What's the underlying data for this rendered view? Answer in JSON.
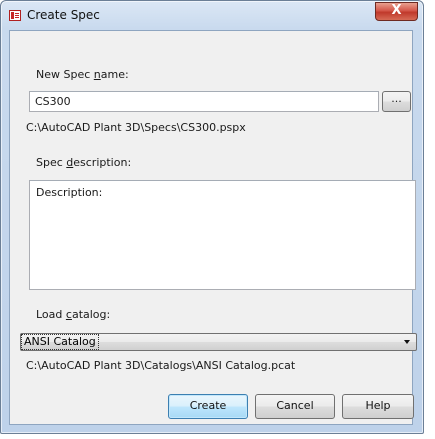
{
  "window": {
    "title": "Create Spec",
    "close_glyph": "X"
  },
  "spec_name": {
    "label_pre": "New Spec ",
    "label_key": "n",
    "label_post": "ame:",
    "value": "CS300",
    "browse_label": "...",
    "path": "C:\\AutoCAD Plant 3D\\Specs\\CS300.pspx"
  },
  "description": {
    "label_pre": "Spec ",
    "label_key": "d",
    "label_post": "escription:",
    "value": "Description:"
  },
  "catalog": {
    "label_pre": "Load ",
    "label_key": "c",
    "label_post": "atalog:",
    "selected": "ANSI Catalog",
    "path": "C:\\AutoCAD Plant 3D\\Catalogs\\ANSI Catalog.pcat"
  },
  "buttons": {
    "create": "Create",
    "cancel": "Cancel",
    "help": "Help"
  },
  "icons": {
    "app": "spec-app-icon",
    "close": "close-icon",
    "dropdown": "chevron-down-icon"
  },
  "colors": {
    "title_bar": "#c9daee",
    "close_button": "#c0392b",
    "default_button": "#bee6fd"
  }
}
